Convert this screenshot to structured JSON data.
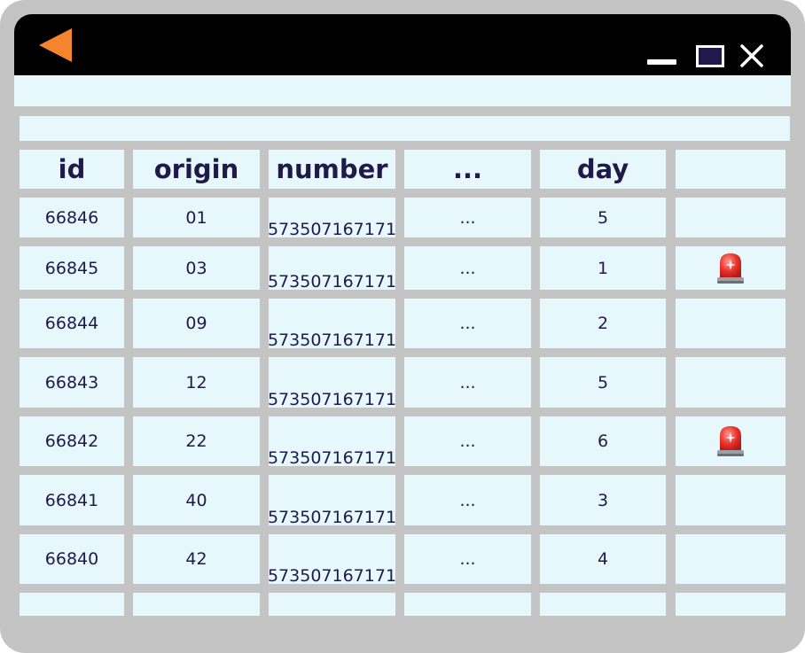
{
  "table": {
    "headers": [
      "id",
      "origin",
      "number",
      "...",
      "day",
      ""
    ],
    "rows": [
      {
        "id": "66846",
        "origin": "01",
        "number": "573507167171",
        "more": "...",
        "day": "5",
        "alert": false
      },
      {
        "id": "66845",
        "origin": "03",
        "number": "573507167171",
        "more": "...",
        "day": "1",
        "alert": true
      },
      {
        "id": "66844",
        "origin": "09",
        "number": "573507167171",
        "more": "...",
        "day": "2",
        "alert": false
      },
      {
        "id": "66843",
        "origin": "12",
        "number": "573507167171",
        "more": "...",
        "day": "5",
        "alert": false
      },
      {
        "id": "66842",
        "origin": "22",
        "number": "573507167171",
        "more": "...",
        "day": "6",
        "alert": true
      },
      {
        "id": "66841",
        "origin": "40",
        "number": "573507167171",
        "more": "...",
        "day": "3",
        "alert": false
      },
      {
        "id": "66840",
        "origin": "42",
        "number": "573507167171",
        "more": "...",
        "day": "4",
        "alert": false
      }
    ]
  },
  "icons": {
    "back": "back-arrow-icon",
    "minimize": "minimize-icon",
    "maximize": "maximize-icon",
    "close": "close-icon",
    "alert": "siren-icon"
  },
  "colors": {
    "titlebar": "#000000",
    "frame": "#c4c4c4",
    "cell": "#e6f8fc",
    "accent": "#f5852c",
    "text": "#1f1a4a",
    "alert": "#e8302a"
  }
}
